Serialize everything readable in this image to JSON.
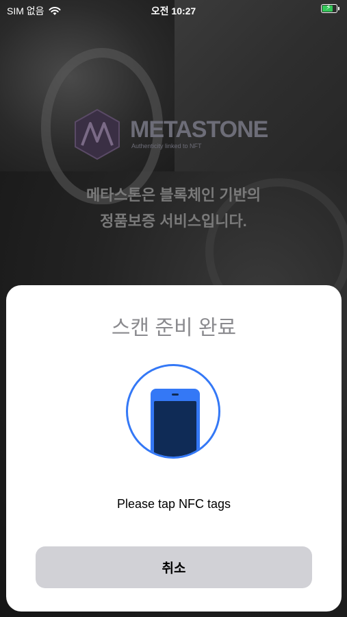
{
  "status_bar": {
    "carrier": "SIM 없음",
    "time": "오전 10:27",
    "wifi_icon": "wifi-icon",
    "battery_icon": "battery-charging-icon"
  },
  "background_app": {
    "logo_word": "METASTONE",
    "logo_tagline": "Authenticity linked to NFT",
    "headline_line1": "메타스톤은 블록체인 기반의",
    "headline_line2": "정품보증 서비스입니다."
  },
  "nfc_sheet": {
    "title": "스캔 준비 완료",
    "icon": "phone-nfc-icon",
    "message": "Please tap NFC tags",
    "cancel_label": "취소"
  },
  "colors": {
    "accent": "#3478f6",
    "phone_screen": "#0f2b56",
    "cancel_button": "#d1d1d6",
    "battery": "#34c759"
  }
}
